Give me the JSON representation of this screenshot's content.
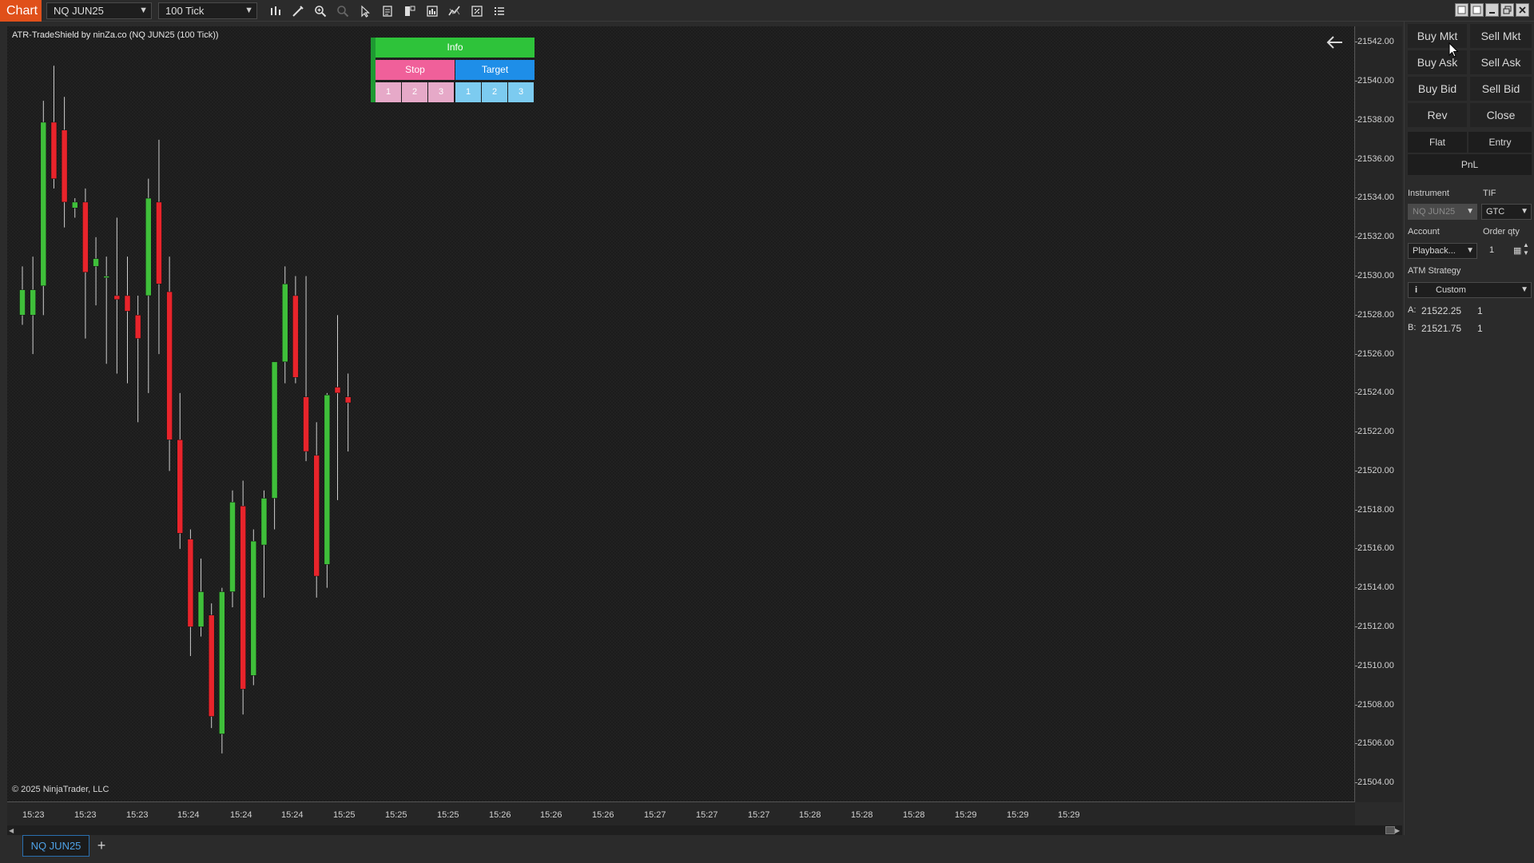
{
  "toolbar": {
    "chart_tab": "Chart",
    "instrument": "NQ JUN25",
    "interval": "100 Tick",
    "icons": [
      "bar-type-icon",
      "draw-icon",
      "zoom-in-icon",
      "zoom-out-icon",
      "pointer-icon",
      "template-icon",
      "data-box-icon",
      "strategies-icon",
      "indicators-icon",
      "properties-icon",
      "list-icon"
    ]
  },
  "chart": {
    "title": "ATR-TradeShield by ninZa.co (NQ JUN25 (100 Tick))",
    "copyright": "© 2025 NinjaTrader, LLC",
    "up_color": "#3fbf3a",
    "down_color": "#e8242b"
  },
  "tradeshield": {
    "info": "Info",
    "stop": "Stop",
    "target": "Target",
    "stop_levels": [
      "1",
      "2",
      "3"
    ],
    "target_levels": [
      "1",
      "2",
      "3"
    ]
  },
  "y_axis": {
    "ticks": [
      "21542.00",
      "21540.00",
      "21538.00",
      "21536.00",
      "21534.00",
      "21532.00",
      "21530.00",
      "21528.00",
      "21526.00",
      "21524.00",
      "21522.00",
      "21520.00",
      "21518.00",
      "21516.00",
      "21514.00",
      "21512.00",
      "21510.00",
      "21508.00",
      "21506.00",
      "21504.00"
    ]
  },
  "x_axis": {
    "ticks": [
      "15:23",
      "15:23",
      "15:23",
      "15:24",
      "15:24",
      "15:24",
      "15:25",
      "15:25",
      "15:25",
      "15:26",
      "15:26",
      "15:26",
      "15:27",
      "15:27",
      "15:27",
      "15:28",
      "15:28",
      "15:28",
      "15:29",
      "15:29",
      "15:29"
    ]
  },
  "chart_data": {
    "type": "candlestick",
    "ylim": [
      21503,
      21543
    ],
    "candles": [
      {
        "o": 21528.0,
        "h": 21530.5,
        "l": 21527.5,
        "c": 21529.3
      },
      {
        "o": 21528.0,
        "h": 21531.0,
        "l": 21526.0,
        "c": 21529.3
      },
      {
        "o": 21529.5,
        "h": 21539.0,
        "l": 21528.0,
        "c": 21537.9
      },
      {
        "o": 21537.9,
        "h": 21540.8,
        "l": 21534.5,
        "c": 21535.0
      },
      {
        "o": 21537.5,
        "h": 21539.2,
        "l": 21532.5,
        "c": 21533.8
      },
      {
        "o": 21533.5,
        "h": 21534.0,
        "l": 21533.0,
        "c": 21533.8
      },
      {
        "o": 21533.8,
        "h": 21534.5,
        "l": 21526.8,
        "c": 21530.2
      },
      {
        "o": 21530.5,
        "h": 21532.0,
        "l": 21528.5,
        "c": 21530.9
      },
      {
        "o": 21530.0,
        "h": 21531.0,
        "l": 21525.5,
        "c": 21530.0
      },
      {
        "o": 21529.0,
        "h": 21533.0,
        "l": 21525.0,
        "c": 21528.8
      },
      {
        "o": 21529.0,
        "h": 21531.0,
        "l": 21524.5,
        "c": 21528.2
      },
      {
        "o": 21528.0,
        "h": 21529.0,
        "l": 21522.5,
        "c": 21526.8
      },
      {
        "o": 21529.0,
        "h": 21535.0,
        "l": 21524.0,
        "c": 21534.0
      },
      {
        "o": 21533.8,
        "h": 21537.0,
        "l": 21526.0,
        "c": 21529.6
      },
      {
        "o": 21529.2,
        "h": 21531.0,
        "l": 21520.0,
        "c": 21521.6
      },
      {
        "o": 21521.6,
        "h": 21524.0,
        "l": 21516.0,
        "c": 21516.8
      },
      {
        "o": 21516.5,
        "h": 21517.0,
        "l": 21510.5,
        "c": 21512.0
      },
      {
        "o": 21512.0,
        "h": 21515.5,
        "l": 21511.5,
        "c": 21513.8
      },
      {
        "o": 21512.6,
        "h": 21513.2,
        "l": 21506.8,
        "c": 21507.4
      },
      {
        "o": 21506.5,
        "h": 21514.0,
        "l": 21505.5,
        "c": 21513.8
      },
      {
        "o": 21513.8,
        "h": 21519.0,
        "l": 21513.0,
        "c": 21518.4
      },
      {
        "o": 21518.2,
        "h": 21519.5,
        "l": 21507.5,
        "c": 21508.8
      },
      {
        "o": 21509.5,
        "h": 21517.0,
        "l": 21509.0,
        "c": 21516.4
      },
      {
        "o": 21516.2,
        "h": 21519.0,
        "l": 21513.5,
        "c": 21518.6
      },
      {
        "o": 21518.6,
        "h": 21525.5,
        "l": 21517.0,
        "c": 21525.6
      },
      {
        "o": 21525.6,
        "h": 21530.5,
        "l": 21524.5,
        "c": 21529.6
      },
      {
        "o": 21529.0,
        "h": 21530.0,
        "l": 21524.5,
        "c": 21524.8
      },
      {
        "o": 21523.8,
        "h": 21530.0,
        "l": 21520.5,
        "c": 21521.0
      },
      {
        "o": 21520.8,
        "h": 21522.5,
        "l": 21513.5,
        "c": 21514.6
      },
      {
        "o": 21515.2,
        "h": 21524.0,
        "l": 21514.0,
        "c": 21523.9
      },
      {
        "o": 21524.3,
        "h": 21528.0,
        "l": 21518.5,
        "c": 21524.0
      },
      {
        "o": 21523.8,
        "h": 21525.0,
        "l": 21521.0,
        "c": 21523.5
      }
    ]
  },
  "panel": {
    "buttons": {
      "buy_mkt": "Buy Mkt",
      "sell_mkt": "Sell Mkt",
      "buy_ask": "Buy Ask",
      "sell_ask": "Sell Ask",
      "buy_bid": "Buy Bid",
      "sell_bid": "Sell Bid",
      "rev": "Rev",
      "close": "Close",
      "flat": "Flat",
      "entry": "Entry",
      "pnl": "PnL"
    },
    "labels": {
      "instrument": "Instrument",
      "tif": "TIF",
      "account": "Account",
      "order_qty": "Order qty",
      "atm_strategy": "ATM Strategy"
    },
    "fields": {
      "instrument": "NQ JUN25",
      "tif": "GTC",
      "account": "Playback...",
      "order_qty": "1",
      "atm_strategy": "Custom",
      "info_icon": "i"
    },
    "ask": {
      "label": "A:",
      "price": "21522.25",
      "qty": "1"
    },
    "bid": {
      "label": "B:",
      "price": "21521.75",
      "qty": "1"
    }
  },
  "tabs": {
    "active": "NQ JUN25",
    "add": "+"
  }
}
